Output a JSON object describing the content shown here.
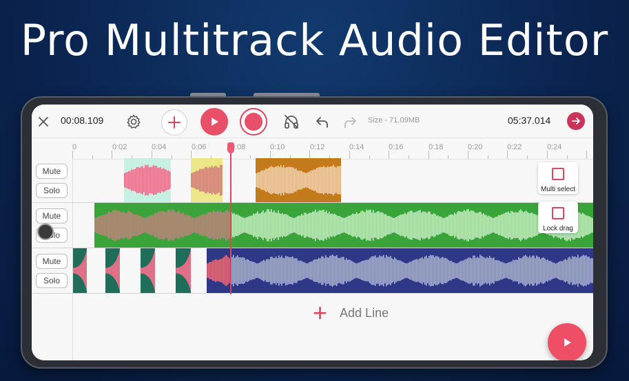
{
  "headline": "Pro Multitrack Audio Editor",
  "toolbar": {
    "current_time": "00:08.109",
    "size": "Size - 71.09MB",
    "total_time": "05:37.014"
  },
  "ruler": {
    "ticks": [
      "0",
      "0:02",
      "0:04",
      "0:06",
      "0:08",
      "0:10",
      "0:12",
      "0:14",
      "0:16",
      "0:18",
      "0:20",
      "0:22",
      "0:24"
    ]
  },
  "tracks": [
    {
      "mute_label": "Mute",
      "solo_label": "Solo"
    },
    {
      "mute_label": "Mute",
      "solo_label": "Solo"
    },
    {
      "mute_label": "Mute",
      "solo_label": "Solo"
    }
  ],
  "side_panel": {
    "multi_select": "Multi select",
    "lock_drag": "Lock drag"
  },
  "add_line": {
    "label": "Add Line"
  },
  "icons": {
    "close": "close-icon",
    "settings": "gear-icon",
    "add": "plus-icon",
    "play": "play-icon",
    "record": "record-icon",
    "headphones": "headphones-off-icon",
    "undo": "undo-icon",
    "redo": "redo-icon",
    "export": "arrow-right-icon"
  },
  "colors": {
    "accent": "#e0455f",
    "clip_pink": "#e07088",
    "clip_mint": "#c8f0e2",
    "clip_yellow": "#ece88a",
    "clip_orange": "#c27a1a",
    "clip_green": "#3aa33a",
    "clip_navy": "#2f3887",
    "clip_teal": "#1f6e5a"
  }
}
